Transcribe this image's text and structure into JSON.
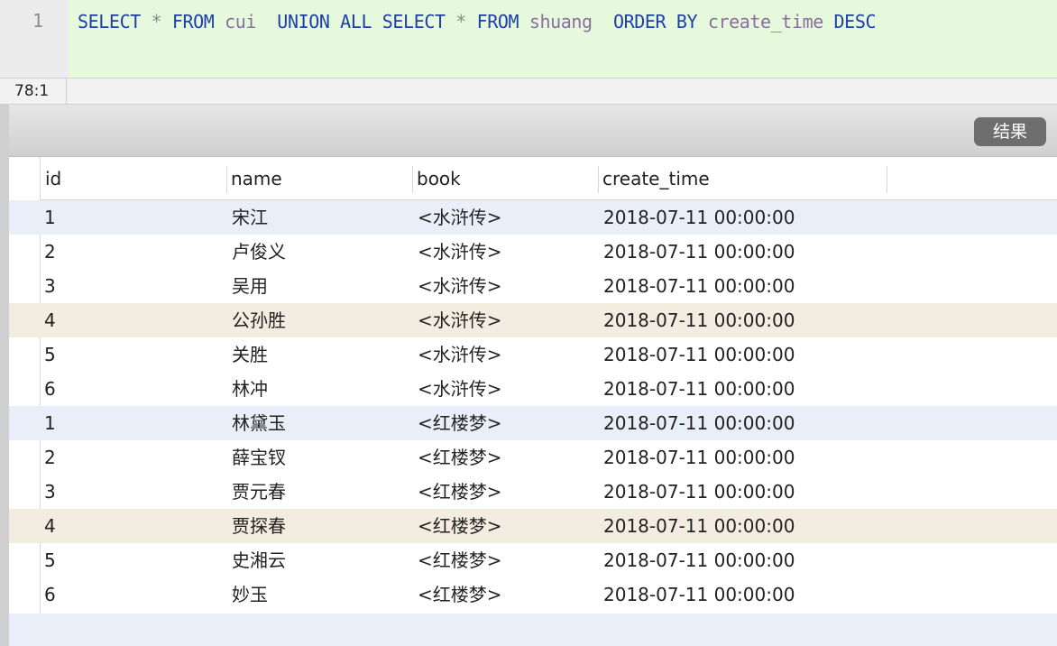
{
  "editor": {
    "line_number": "1",
    "tokens": [
      {
        "text": "SELECT",
        "kind": "kw"
      },
      {
        "text": " ",
        "kind": "sp"
      },
      {
        "text": "*",
        "kind": "op"
      },
      {
        "text": " ",
        "kind": "sp"
      },
      {
        "text": "FROM",
        "kind": "kw"
      },
      {
        "text": " ",
        "kind": "sp"
      },
      {
        "text": "cui",
        "kind": "id"
      },
      {
        "text": "  ",
        "kind": "sp"
      },
      {
        "text": "UNION",
        "kind": "kw"
      },
      {
        "text": " ",
        "kind": "sp"
      },
      {
        "text": "ALL",
        "kind": "kw"
      },
      {
        "text": " ",
        "kind": "sp"
      },
      {
        "text": "SELECT",
        "kind": "kw"
      },
      {
        "text": " ",
        "kind": "sp"
      },
      {
        "text": "*",
        "kind": "op"
      },
      {
        "text": " ",
        "kind": "sp"
      },
      {
        "text": "FROM",
        "kind": "kw"
      },
      {
        "text": " ",
        "kind": "sp"
      },
      {
        "text": "shuang",
        "kind": "id"
      },
      {
        "text": "  ",
        "kind": "sp"
      },
      {
        "text": "ORDER",
        "kind": "kw"
      },
      {
        "text": " ",
        "kind": "sp"
      },
      {
        "text": "BY",
        "kind": "kw"
      },
      {
        "text": " ",
        "kind": "sp"
      },
      {
        "text": "create_time",
        "kind": "id"
      },
      {
        "text": " ",
        "kind": "sp"
      },
      {
        "text": "DESC",
        "kind": "kw"
      }
    ]
  },
  "status": {
    "cursor_position": "78:1"
  },
  "toolbar": {
    "result_tab_label": "结果"
  },
  "colors": {
    "highlight_blue": "#e9eef8",
    "highlight_beige": "#f3ece0",
    "current_line": "#e6f9dc"
  },
  "table": {
    "columns": [
      "id",
      "name",
      "book",
      "create_time"
    ],
    "rows": [
      {
        "id": "1",
        "name": "宋江",
        "book": "<水浒传>",
        "create_time": "2018-07-11 00:00:00",
        "tint": "blue"
      },
      {
        "id": "2",
        "name": "卢俊义",
        "book": "<水浒传>",
        "create_time": "2018-07-11 00:00:00",
        "tint": "none"
      },
      {
        "id": "3",
        "name": "吴用",
        "book": "<水浒传>",
        "create_time": "2018-07-11 00:00:00",
        "tint": "none"
      },
      {
        "id": "4",
        "name": "公孙胜",
        "book": "<水浒传>",
        "create_time": "2018-07-11 00:00:00",
        "tint": "beige"
      },
      {
        "id": "5",
        "name": "关胜",
        "book": "<水浒传>",
        "create_time": "2018-07-11 00:00:00",
        "tint": "none"
      },
      {
        "id": "6",
        "name": "林冲",
        "book": "<水浒传>",
        "create_time": "2018-07-11 00:00:00",
        "tint": "none"
      },
      {
        "id": "1",
        "name": "林黛玉",
        "book": "<红楼梦>",
        "create_time": "2018-07-11 00:00:00",
        "tint": "blue"
      },
      {
        "id": "2",
        "name": "薛宝钗",
        "book": "<红楼梦>",
        "create_time": "2018-07-11 00:00:00",
        "tint": "none"
      },
      {
        "id": "3",
        "name": "贾元春",
        "book": "<红楼梦>",
        "create_time": "2018-07-11 00:00:00",
        "tint": "none"
      },
      {
        "id": "4",
        "name": "贾探春",
        "book": "<红楼梦>",
        "create_time": "2018-07-11 00:00:00",
        "tint": "beige"
      },
      {
        "id": "5",
        "name": "史湘云",
        "book": "<红楼梦>",
        "create_time": "2018-07-11 00:00:00",
        "tint": "none"
      },
      {
        "id": "6",
        "name": "妙玉",
        "book": "<红楼梦>",
        "create_time": "2018-07-11 00:00:00",
        "tint": "none"
      }
    ]
  }
}
